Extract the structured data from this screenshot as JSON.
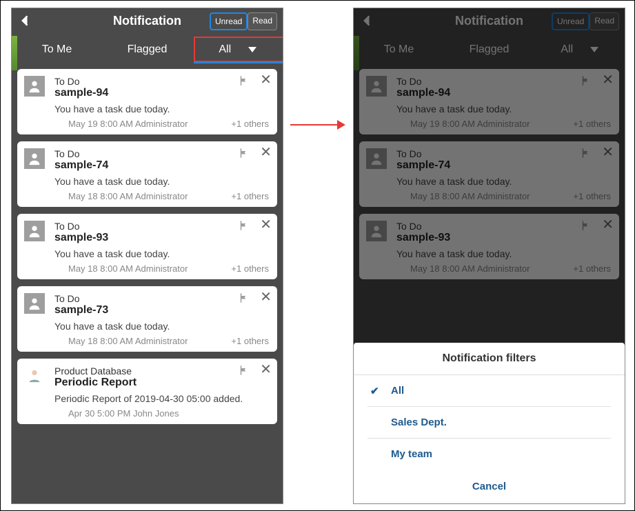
{
  "header": {
    "title": "Notification",
    "unread_label": "Unread",
    "read_label": "Read"
  },
  "tabs": {
    "to_me": "To Me",
    "flagged": "Flagged",
    "all": "All"
  },
  "cards": [
    {
      "category": "To Do",
      "title": "sample-94",
      "body": "You have a task due today.",
      "date": "May 19 8:00 AM",
      "user": "Administrator",
      "others": "+1 others"
    },
    {
      "category": "To Do",
      "title": "sample-74",
      "body": "You have a task due today.",
      "date": "May 18 8:00 AM",
      "user": "Administrator",
      "others": "+1 others"
    },
    {
      "category": "To Do",
      "title": "sample-93",
      "body": "You have a task due today.",
      "date": "May 18 8:00 AM",
      "user": "Administrator",
      "others": "+1 others"
    },
    {
      "category": "To Do",
      "title": "sample-73",
      "body": "You have a task due today.",
      "date": "May 18 8:00 AM",
      "user": "Administrator",
      "others": "+1 others"
    },
    {
      "category": "Product Database",
      "title": "Periodic Report",
      "body": "Periodic Report of 2019-04-30 05:00 added.",
      "date": "Apr 30 5:00 PM",
      "user": "John Jones",
      "others": ""
    }
  ],
  "sheet": {
    "title": "Notification filters",
    "items": [
      "All",
      "Sales Dept.",
      "My team"
    ],
    "selected": "All",
    "cancel": "Cancel"
  }
}
